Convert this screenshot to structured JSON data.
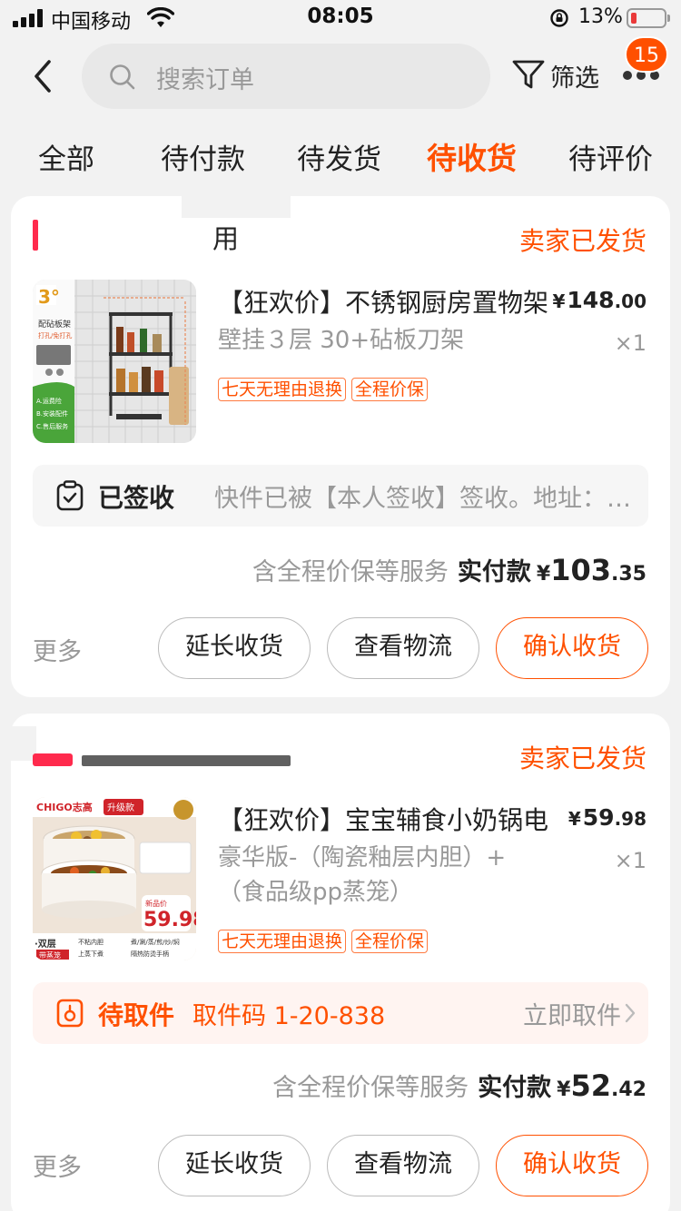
{
  "status_bar": {
    "carrier": "中国移动",
    "time": "08:05",
    "battery": "13%"
  },
  "nav": {
    "search_placeholder": "搜索订单",
    "filter_label": "筛选",
    "badge_count": "15"
  },
  "tabs": [
    {
      "label": "全部",
      "active": false
    },
    {
      "label": "待付款",
      "active": false
    },
    {
      "label": "待发货",
      "active": false
    },
    {
      "label": "待收货",
      "active": true
    },
    {
      "label": "待评价",
      "active": false
    }
  ],
  "orders": [
    {
      "shop_name_partial": "用",
      "ship_status": "卖家已发货",
      "title": "【狂欢价】不锈钢厨房置物架",
      "spec": "壁挂３层 30+砧板刀架",
      "price_yen": "¥",
      "price_int": "148",
      "price_dec": ".00",
      "qty": "×1",
      "tags": [
        "七天无理由退换",
        "全程价保"
      ],
      "track_status": "已签收",
      "track_detail": "快件已被【本人签收】签收。地址：…",
      "service_text": "含全程价保等服务",
      "paid_label": "实付款",
      "paid_yen": "¥",
      "paid_int": "103",
      "paid_dec": ".35",
      "more": "更多",
      "btn_extend": "延长收货",
      "btn_logistics": "查看物流",
      "btn_confirm": "确认收货",
      "thumb_labels": {
        "badge": "3°",
        "line1": "配砧板架",
        "line2": "打孔/免打孔",
        "a": "A.运费险",
        "b": "B.安装配件",
        "c": "C.售后服务"
      }
    },
    {
      "ship_status": "卖家已发货",
      "title": "【狂欢价】宝宝辅食小奶锅电",
      "spec": "豪华版-（陶瓷釉层内胆）+（食品级pp蒸笼）",
      "price_yen": "¥",
      "price_int": "59",
      "price_dec": ".98",
      "qty": "×1",
      "tags": [
        "七天无理由退换",
        "全程价保"
      ],
      "track_status": "待取件",
      "pickup_code": "取件码 1-20-838",
      "pickup_action": "立即取件",
      "service_text": "含全程价保等服务",
      "paid_label": "实付款",
      "paid_yen": "¥",
      "paid_int": "52",
      "paid_dec": ".42",
      "more": "更多",
      "btn_extend": "延长收货",
      "btn_logistics": "查看物流",
      "btn_confirm": "确认收货",
      "thumb_labels": {
        "brand": "CHIGO志高",
        "upgrade": "升级款",
        "price": "59.98",
        "price_tag": "新品价",
        "layers": "·双层",
        "steamer": "带蒸笼",
        "f1": "不粘内胆",
        "f2": "煮/涮/蒸/煎/炒/焖",
        "f3": "上蒸下煮",
        "f4": "隔热防烫手柄"
      }
    }
  ],
  "colors": {
    "accent": "#ff5000",
    "background": "#f2f2f2"
  }
}
